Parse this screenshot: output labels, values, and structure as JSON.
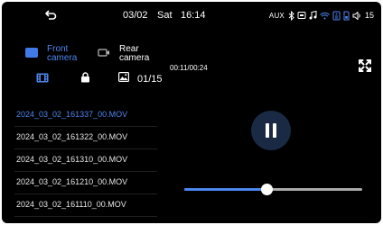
{
  "status_bar": {
    "back_icon": "back-arrow-icon",
    "date": "03/02",
    "day": "Sat",
    "time": "16:14",
    "aux_label": "AUX",
    "icons": [
      "bluetooth-icon",
      "car-icon",
      "music-note-icon",
      "wifi-icon",
      "signal-icon",
      "sd-card-icon",
      "volume-icon"
    ],
    "volume_level": "15"
  },
  "camera": {
    "front_label": "Front\ncamera",
    "rear_label": "Rear\ncamera",
    "selected": "front"
  },
  "tools": {
    "icons": [
      "video-icon",
      "lock-icon",
      "photo-icon"
    ],
    "count": "01/15"
  },
  "recording_time": "00:11/00:24",
  "fullscreen_icon": "fullscreen-icon",
  "files": [
    {
      "name": "2024_03_02_161337_00.MOV",
      "active": true
    },
    {
      "name": "2024_03_02_161322_00.MOV",
      "active": false
    },
    {
      "name": "2024_03_02_161310_00.MOV",
      "active": false
    },
    {
      "name": "2024_03_02_161210_00.MOV",
      "active": false
    },
    {
      "name": "2024_03_02_161110_00.MOV",
      "active": false
    }
  ],
  "playback": {
    "state": "playing",
    "progress": 0.46
  },
  "colors": {
    "background": "#000000",
    "accent": "#4d86ee",
    "pause_button": "#1b2a44",
    "text": "#ffffff"
  }
}
